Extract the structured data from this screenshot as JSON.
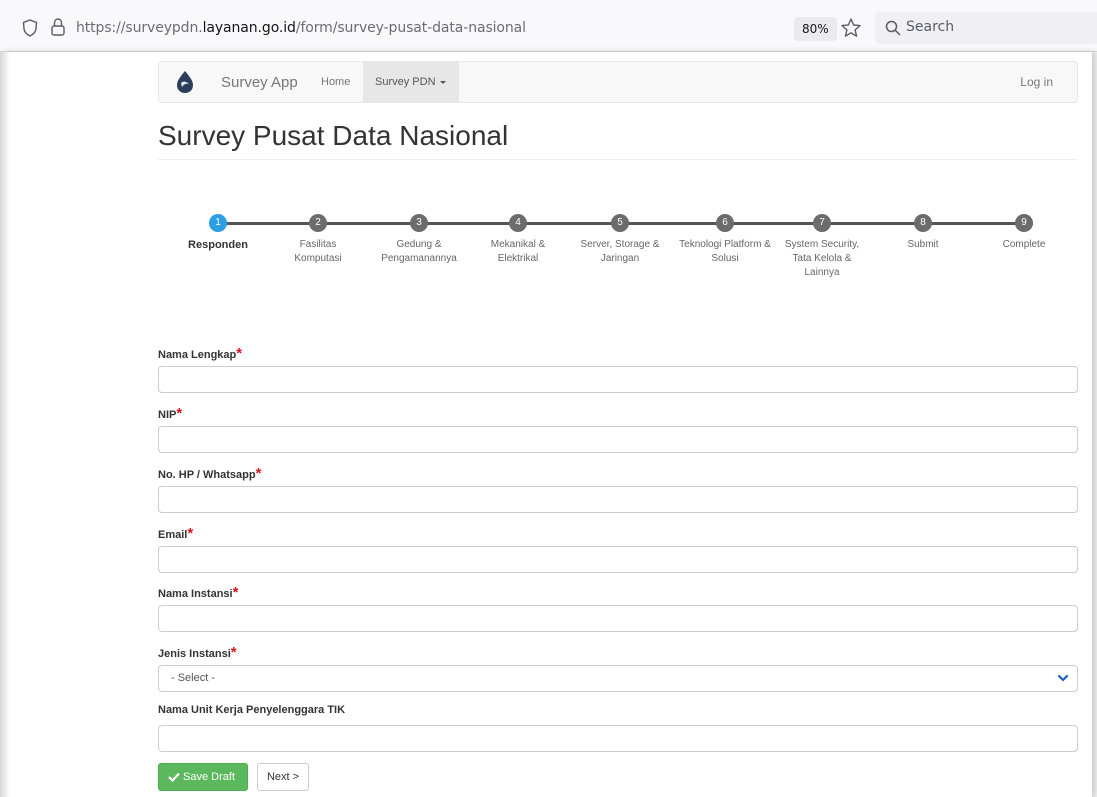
{
  "browser": {
    "url_prefix": "https://surveypdn.",
    "url_domain": "layanan.go.id",
    "url_path": "/form/survey-pusat-data-nasional",
    "zoom": "80%",
    "search_label": "Search"
  },
  "navbar": {
    "brand": "Survey App",
    "home": "Home",
    "survey_menu": "Survey PDN",
    "login": "Log in"
  },
  "page": {
    "title": "Survey Pusat Data Nasional"
  },
  "steps": [
    {
      "num": "1",
      "label": "Responden",
      "active": true
    },
    {
      "num": "2",
      "label": "Fasilitas Komputasi"
    },
    {
      "num": "3",
      "label": "Gedung & Pengamanannya"
    },
    {
      "num": "4",
      "label": "Mekanikal & Elektrikal"
    },
    {
      "num": "5",
      "label": "Server, Storage & Jaringan"
    },
    {
      "num": "6",
      "label": "Teknologi Platform & Solusi"
    },
    {
      "num": "7",
      "label": "System Security, Tata Kelola & Lainnya"
    },
    {
      "num": "8",
      "label": "Submit"
    },
    {
      "num": "9",
      "label": "Complete"
    }
  ],
  "form": {
    "required_mark": "*",
    "fields": [
      {
        "label": "Nama Lengkap",
        "required": true,
        "value": ""
      },
      {
        "label": "NIP",
        "required": true,
        "value": ""
      },
      {
        "label": "No. HP / Whatsapp",
        "required": true,
        "value": ""
      },
      {
        "label": "Email",
        "required": true,
        "value": ""
      },
      {
        "label": "Nama Instansi",
        "required": true,
        "value": ""
      },
      {
        "label": "Jenis Instansi",
        "required": true,
        "value": "- Select -",
        "type": "select"
      },
      {
        "label": "Nama Unit Kerja Penyelenggara TIK",
        "required": false,
        "value": ""
      }
    ]
  },
  "buttons": {
    "save": "Save Draft",
    "next": "Next >"
  },
  "colors": {
    "active_step": "#2a9fe5",
    "inactive_step": "#6c6c6c",
    "required": "#d9141a",
    "save_button": "#5cb85c"
  }
}
